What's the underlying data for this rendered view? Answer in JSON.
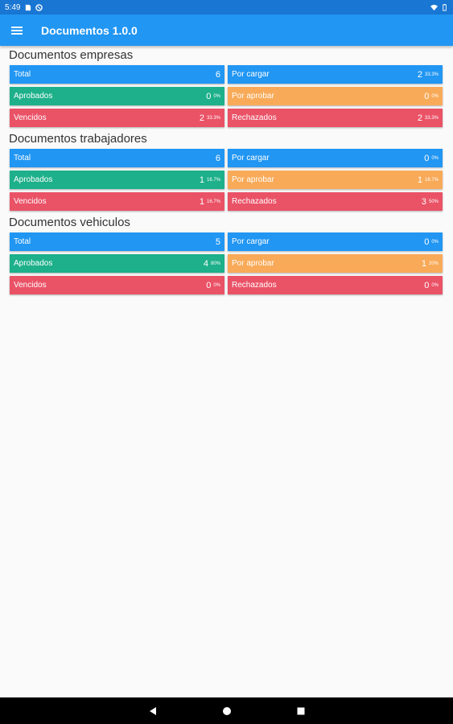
{
  "status_bar": {
    "time": "5:49"
  },
  "app_bar": {
    "title": "Documentos 1.0.0"
  },
  "sections": [
    {
      "title": "Documentos empresas",
      "cells": [
        {
          "label": "Total",
          "count": "6",
          "pct": "",
          "color": "blue"
        },
        {
          "label": "Por cargar",
          "count": "2",
          "pct": "33.3%",
          "color": "blue"
        },
        {
          "label": "Aprobados",
          "count": "0",
          "pct": "0%",
          "color": "green"
        },
        {
          "label": "Por aprobar",
          "count": "0",
          "pct": "0%",
          "color": "orange"
        },
        {
          "label": "Vencidos",
          "count": "2",
          "pct": "33.3%",
          "color": "red"
        },
        {
          "label": "Rechazados",
          "count": "2",
          "pct": "33.3%",
          "color": "red"
        }
      ]
    },
    {
      "title": "Documentos trabajadores",
      "cells": [
        {
          "label": "Total",
          "count": "6",
          "pct": "",
          "color": "blue"
        },
        {
          "label": "Por cargar",
          "count": "0",
          "pct": "0%",
          "color": "blue"
        },
        {
          "label": "Aprobados",
          "count": "1",
          "pct": "16.7%",
          "color": "green"
        },
        {
          "label": "Por aprobar",
          "count": "1",
          "pct": "16.7%",
          "color": "orange"
        },
        {
          "label": "Vencidos",
          "count": "1",
          "pct": "16.7%",
          "color": "red"
        },
        {
          "label": "Rechazados",
          "count": "3",
          "pct": "50%",
          "color": "red"
        }
      ]
    },
    {
      "title": "Documentos vehiculos",
      "cells": [
        {
          "label": "Total",
          "count": "5",
          "pct": "",
          "color": "blue"
        },
        {
          "label": "Por cargar",
          "count": "0",
          "pct": "0%",
          "color": "blue"
        },
        {
          "label": "Aprobados",
          "count": "4",
          "pct": "80%",
          "color": "green"
        },
        {
          "label": "Por aprobar",
          "count": "1",
          "pct": "20%",
          "color": "orange"
        },
        {
          "label": "Vencidos",
          "count": "0",
          "pct": "0%",
          "color": "red"
        },
        {
          "label": "Rechazados",
          "count": "0",
          "pct": "0%",
          "color": "red"
        }
      ]
    }
  ],
  "colors": {
    "blue": "#2196f3",
    "green": "#1db08a",
    "orange": "#f8aa58",
    "red": "#ea5266",
    "app_bar": "#2196f3",
    "status_bar": "#1976d2"
  },
  "icons": {
    "menu": "menu-icon",
    "nav_back": "back-triangle-icon",
    "nav_home": "home-circle-icon",
    "nav_recents": "recents-square-icon"
  }
}
